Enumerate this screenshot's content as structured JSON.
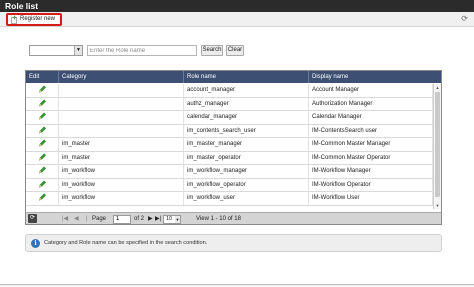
{
  "window": {
    "title": "Role list"
  },
  "toolbar": {
    "register_label": "Register new",
    "refresh_icon": "refresh-icon"
  },
  "search": {
    "select_value": "",
    "placeholder": "Enter the Role name",
    "search_label": "Search",
    "clear_label": "Clear"
  },
  "grid": {
    "columns": [
      "Edit",
      "Category",
      "Role name",
      "Display name"
    ],
    "rows": [
      {
        "category": "",
        "role_name": "account_manager",
        "display_name": "Account Manager"
      },
      {
        "category": "",
        "role_name": "authz_manager",
        "display_name": "Authorization Manager"
      },
      {
        "category": "",
        "role_name": "calendar_manager",
        "display_name": "Calendar Manager"
      },
      {
        "category": "",
        "role_name": "im_contents_search_user",
        "display_name": "IM-ContentsSearch user"
      },
      {
        "category": "im_master",
        "role_name": "im_master_manager",
        "display_name": "IM-Common Master Manager"
      },
      {
        "category": "im_master",
        "role_name": "im_master_operator",
        "display_name": "IM-Common Master Operator"
      },
      {
        "category": "im_workflow",
        "role_name": "im_workflow_manager",
        "display_name": "IM-Workflow Manager"
      },
      {
        "category": "im_workflow",
        "role_name": "im_workflow_operator",
        "display_name": "IM-Workflow Operator"
      },
      {
        "category": "im_workflow",
        "role_name": "im_workflow_user",
        "display_name": "IM-Workflow User"
      }
    ],
    "edit_icon": "pencil-icon",
    "accent_color": "#3d4f73"
  },
  "pager": {
    "page_label": "Page",
    "page_value": "1",
    "of_label": "of 2",
    "rows_per_page": "10",
    "view_text": "View 1 - 10 of 18"
  },
  "info": {
    "message": "Category and Role name can be specified in the search condition."
  }
}
